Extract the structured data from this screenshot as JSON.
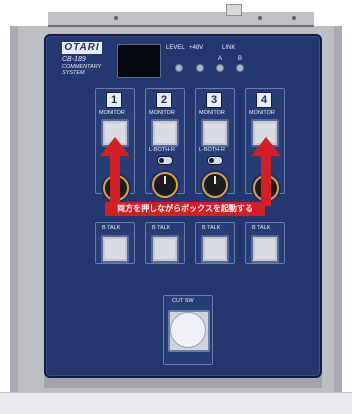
{
  "device": {
    "brand": "OTARI",
    "model": "CB-189",
    "system_label": "COMMENTARY SYSTEM"
  },
  "indicators": {
    "level_label": "LEVEL",
    "phantom_label": "+48V",
    "link_label": "LINK",
    "link_a": "A",
    "link_b": "B"
  },
  "channels": [
    {
      "number": "1",
      "monitor_label": "MONITOR",
      "talk_label": "B TALK"
    },
    {
      "number": "2",
      "monitor_label": "MONITOR",
      "routing_label": "L-BOTH-R",
      "talk_label": "B TALK"
    },
    {
      "number": "3",
      "monitor_label": "MONITOR",
      "routing_label": "L-BOTH-R",
      "talk_label": "B TALK"
    },
    {
      "number": "4",
      "monitor_label": "MONITOR",
      "talk_label": "B TALK"
    }
  ],
  "cut": {
    "label": "CUT SW"
  },
  "annotation": {
    "text": "両方を押しながらボックスを起動する"
  },
  "colors": {
    "panel": "#23386e",
    "arrow": "#d31e24",
    "knob_ring": "#d7a043"
  }
}
